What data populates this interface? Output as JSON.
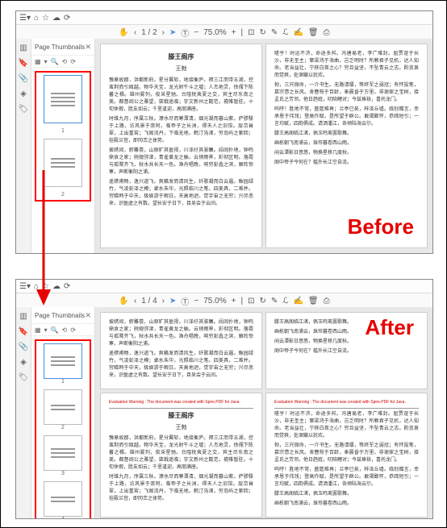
{
  "labels": {
    "before": "Before",
    "after": "After"
  },
  "thumbs_panel": {
    "title": "Page Thumbnails"
  },
  "toolbar": {
    "page_before": "1 / 2",
    "page_after": "1 / 4",
    "zoom": "75.0%"
  },
  "doc": {
    "title": "滕王阁序",
    "author": "王勃",
    "p1": "豫章故郡，洪都新府。星分翼轸，地接衡庐。襟三江而带五湖，控蛮荆而引瓯越。物华天宝，龙光射牛斗之墟；人杰地灵，徐孺下陈蕃之榻。雄州雾列，俊采星驰。台隍枕夷夏之交，宾主尽东南之美。都督阎公之雅望，棨戟遥临；宇文新州之懿范，襜帷暂驻。十旬休假，胜友如云；千里逢迎，高朋满座。",
    "p2": "时维九月，序属三秋。潦水尽而寒潭清，烟光凝而暮山紫。俨骖騑于上路，访风景于崇阿。临帝子之长洲，得天人之旧馆。层峦耸翠，上出重霄；飞阁流丹，下临无地。鹤汀凫渚，穷岛屿之萦回；桂殿兰宫，即冈峦之体势。",
    "p3": "披绣闼，俯雕甍，山原旷其盈视，川泽纡其骇瞩。闾阎扑地，钟鸣鼎食之家；舸舰弥津，青雀黄龙之舳。云销雨霁，彩彻区明。落霞与孤鹜齐飞，秋水共长天一色。渔舟唱晚，响穷彭蠡之滨，雁阵惊寒，声断衡阳之浦。",
    "p4": "遥襟甫畅，逸兴遄飞。爽籁发而清风生，纤歌凝而白云遏。睢园绿竹，气凌彭泽之樽；邺水朱华，光照临川之笔。四美具，二难并。穷睇眄于中天，极娱游于暇日。天高地迥，觉宇宙之无穷；兴尽悲来，识盈虚之有数。望长安于日下，目吴会于云间。",
    "r1": "嗟乎！时运不济，命途多舛。冯唐易老，李广难封。屈贾谊于长沙，非无圣主；窜梁鸿于海曲，岂乏明时？所赖君子见机，达人知命。老当益壮，宁移白首之心？穷且益坚，不坠青云之志。酌贪泉而觉爽，处涸辙以犹欢。",
    "r2": "勃，三尺微命，一介书生。无路请缨，等终军之弱冠；有怀投笔，慕宗悫之长风。舍簪笏于百龄，奉晨昏于万里。非谢家之宝树，接孟氏之芳邻。他日趋庭，叨陪鲤对；今兹捧袂，喜托龙门。",
    "r3": "呜呼！胜地不常，盛筵难再；兰亭已矣，梓泽丘墟。临别赠言，幸承恩于伟饯；登高作赋，是所望于群公。敢竭鄙怀，恭疏短引；一言均赋，四韵俱成。请洒潘江，各倾陆海云尔。",
    "r4": "滕王高阁临江渚，佩玉鸣鸾罢歌舞。",
    "r5": "画栋朝飞南浦云，珠帘暮卷西山雨。",
    "r6": "闲云潭影日悠悠，物换星移几度秋。",
    "r7": "阁中帝子今何在？槛外长江空自流。"
  },
  "watermark": "Evaluation Warning : The document was created with Spire.PDF for Java.",
  "thumb_labels": {
    "n1": "1",
    "n2": "2",
    "n3": "3",
    "n4": "4"
  }
}
